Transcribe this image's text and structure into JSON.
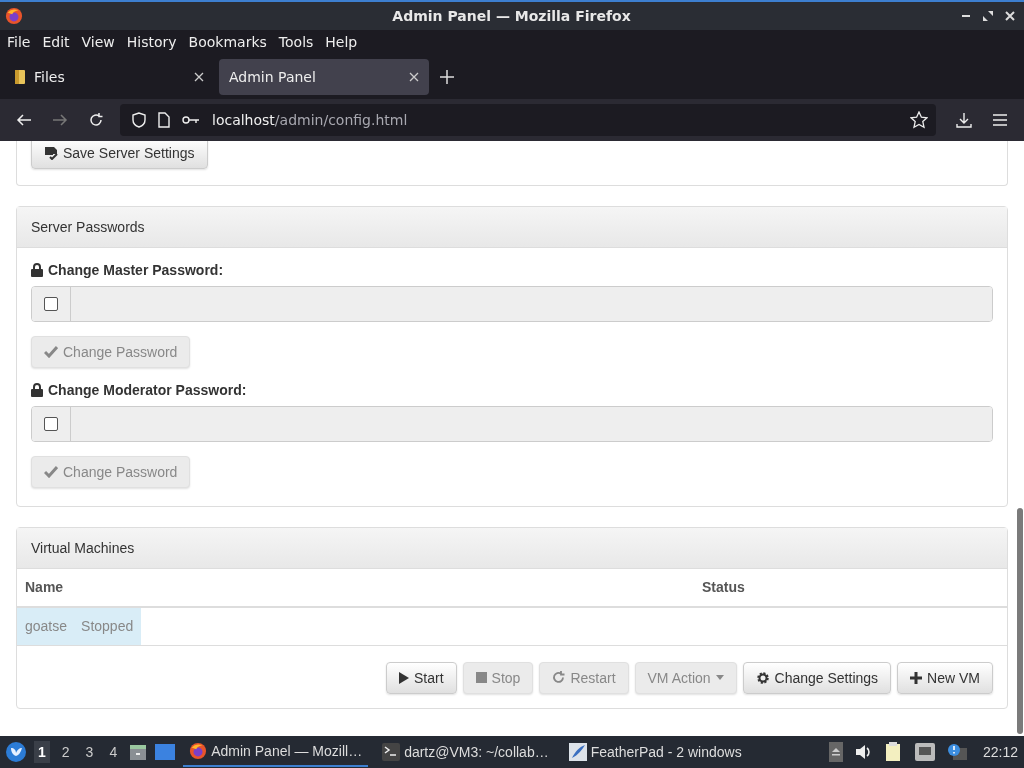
{
  "window": {
    "title": "Admin Panel — Mozilla Firefox"
  },
  "menu": [
    "File",
    "Edit",
    "View",
    "History",
    "Bookmarks",
    "Tools",
    "Help"
  ],
  "tabs": [
    {
      "label": "Files",
      "selected": false,
      "kind": "folder"
    },
    {
      "label": "Admin Panel",
      "selected": true,
      "kind": "plain"
    }
  ],
  "address": {
    "host": "localhost",
    "path": "/admin/config.html"
  },
  "page": {
    "settings_card": {
      "save_button": "Save Server Settings"
    },
    "passwords_card": {
      "title": "Server Passwords",
      "groups": [
        {
          "label": "Change Master Password:",
          "checked": false,
          "button": "Change Password",
          "disabled": true
        },
        {
          "label": "Change Moderator Password:",
          "checked": false,
          "button": "Change Password",
          "disabled": true
        }
      ]
    },
    "vm_card": {
      "title": "Virtual Machines",
      "columns": [
        "Name",
        "Status"
      ],
      "rows": [
        {
          "name": "goatse",
          "status": "Stopped",
          "selected": true
        }
      ],
      "buttons": [
        {
          "label": "Start",
          "kind": "play",
          "disabled": false
        },
        {
          "label": "Stop",
          "kind": "stop",
          "disabled": true
        },
        {
          "label": "Restart",
          "kind": "restart",
          "disabled": true
        },
        {
          "label": "VM Action",
          "kind": "dropdown",
          "disabled": true
        },
        {
          "label": "Change Settings",
          "kind": "gear",
          "disabled": false
        },
        {
          "label": "New VM",
          "kind": "plus",
          "disabled": false
        }
      ]
    }
  },
  "taskbar": {
    "workspaces": [
      {
        "label": "1",
        "selected": true
      },
      {
        "label": "2",
        "selected": false
      },
      {
        "label": "3",
        "selected": false
      },
      {
        "label": "4",
        "selected": false
      }
    ],
    "tasks": [
      {
        "label": "Admin Panel — Mozill…",
        "kind": "firefox",
        "selected": true
      },
      {
        "label": "dartz@VM3: ~/collab…",
        "kind": "terminal",
        "selected": false
      },
      {
        "label": "FeatherPad - 2 windows",
        "kind": "editor",
        "selected": false
      }
    ],
    "clock": "22:12"
  }
}
